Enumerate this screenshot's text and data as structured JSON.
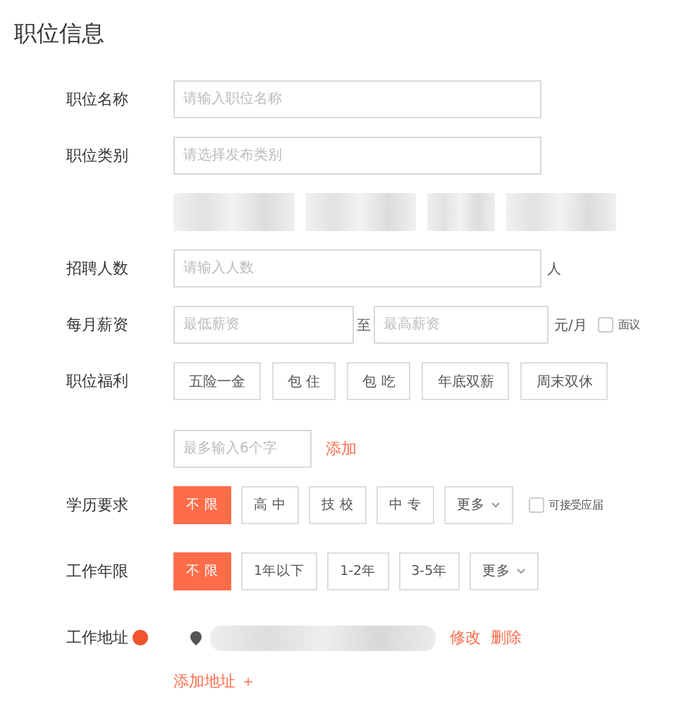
{
  "title": "职位信息",
  "fields": [
    {
      "kind": "input",
      "label": "职位名称",
      "placeholder": "请输入职位名称"
    },
    {
      "kind": "input",
      "label": "职位类别",
      "placeholder": "请选择发布类别"
    },
    {
      "kind": "blurred"
    },
    {
      "kind": "input",
      "label": "招聘人数",
      "placeholder": "请输入人数",
      "unit": "人"
    },
    {
      "kind": "salary",
      "label": "每月薪资",
      "min_placeholder": "最低薪资",
      "separator": "至",
      "max_placeholder": "最高薪资",
      "unit": "元/月",
      "checkbox": {
        "label": "面议",
        "checked": false
      }
    },
    {
      "kind": "tags",
      "label": "职位福利",
      "tags": [
        "五险一金",
        "包 住",
        "包 吃",
        "年底双薪",
        "周末双休"
      ]
    },
    {
      "kind": "custom",
      "placeholder": "最多输入6个字",
      "action": "添加"
    },
    {
      "kind": "options",
      "label": "学历要求",
      "options": [
        {
          "label": "不 限",
          "selected": true
        },
        {
          "label": "高 中",
          "selected": false
        },
        {
          "label": "技 校",
          "selected": false
        },
        {
          "label": "中 专",
          "selected": false
        },
        {
          "label": "更多",
          "selected": false,
          "kind": "dropdown"
        }
      ],
      "checkbox": {
        "label": "可接受应届",
        "checked": false
      }
    },
    {
      "kind": "options",
      "label": "工作年限",
      "options": [
        {
          "label": "不 限",
          "selected": true
        },
        {
          "label": "1年以下",
          "selected": false
        },
        {
          "label": "1-2年",
          "selected": false
        },
        {
          "label": "3-5年",
          "selected": false
        },
        {
          "label": "更多",
          "selected": false,
          "kind": "dropdown"
        }
      ]
    },
    {
      "kind": "address",
      "label": "工作地址",
      "edit": "修改",
      "delete": "删除",
      "add": "添加地址 ＋"
    }
  ]
}
